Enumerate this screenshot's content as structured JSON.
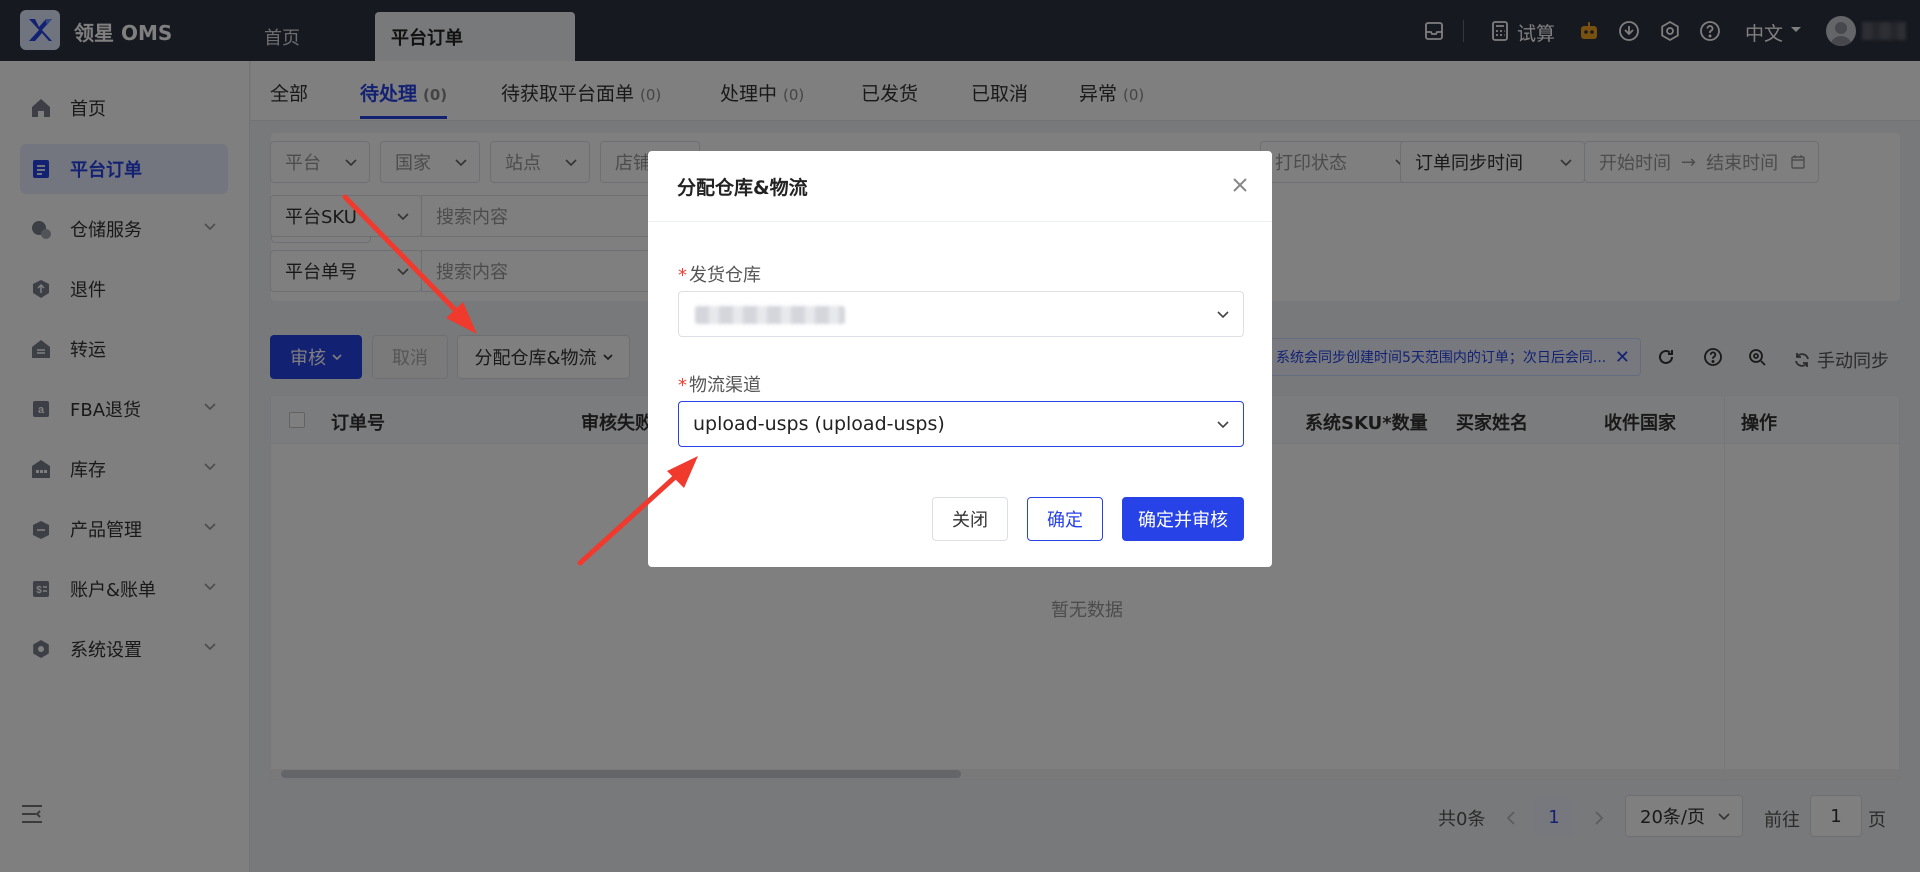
{
  "app": {
    "name": "领星 OMS"
  },
  "top_tabs": [
    {
      "label": "首页",
      "active": false
    },
    {
      "label": "平台订单",
      "active": true
    }
  ],
  "top_right": {
    "trial_label": "试算",
    "language": "中文",
    "icons": [
      "inbox-icon",
      "calculator-icon",
      "robot-icon",
      "download-icon",
      "settings-icon",
      "help-icon",
      "avatar"
    ]
  },
  "sidebar": {
    "items": [
      {
        "label": "首页",
        "icon": "home-icon",
        "active": false,
        "expandable": false
      },
      {
        "label": "平台订单",
        "icon": "order-icon",
        "active": true,
        "expandable": false
      },
      {
        "label": "仓储服务",
        "icon": "warehouse-service-icon",
        "active": false,
        "expandable": true
      },
      {
        "label": "退件",
        "icon": "return-icon",
        "active": false,
        "expandable": false
      },
      {
        "label": "转运",
        "icon": "transfer-icon",
        "active": false,
        "expandable": false
      },
      {
        "label": "FBA退货",
        "icon": "amazon-icon",
        "active": false,
        "expandable": true
      },
      {
        "label": "库存",
        "icon": "inventory-icon",
        "active": false,
        "expandable": true
      },
      {
        "label": "产品管理",
        "icon": "product-icon",
        "active": false,
        "expandable": true
      },
      {
        "label": "账户&账单",
        "icon": "billing-icon",
        "active": false,
        "expandable": true
      },
      {
        "label": "系统设置",
        "icon": "system-settings-icon",
        "active": false,
        "expandable": true
      }
    ]
  },
  "sub_tabs": [
    {
      "label": "全部",
      "count": ""
    },
    {
      "label": "待处理",
      "count": "(0)"
    },
    {
      "label": "待获取平台面单",
      "count": "(0)"
    },
    {
      "label": "处理中",
      "count": "(0)"
    },
    {
      "label": "已发货",
      "count": ""
    },
    {
      "label": "已取消",
      "count": ""
    },
    {
      "label": "异常",
      "count": "(0)"
    }
  ],
  "filters": {
    "platform": "平台",
    "country": "国家",
    "site": "站点",
    "store": "店铺",
    "print_status": "打印状态",
    "sync_time": "订单同步时间",
    "start_time": "开始时间",
    "end_time": "结束时间",
    "sku_type": "平台SKU",
    "sku_placeholder": "搜索内容",
    "order_type": "平台单号",
    "order_placeholder": "搜索内容"
  },
  "actions": {
    "review": "审核",
    "cancel": "取消",
    "assign": "分配仓库&物流",
    "notice": "系统会同步创建时间5天范围内的订单；次日后会同...",
    "manual_sync": "手动同步"
  },
  "table": {
    "columns": [
      "订单号",
      "审核失败",
      "系统SKU*数量",
      "买家姓名",
      "收件国家",
      "操作"
    ],
    "empty_text": "暂无数据"
  },
  "pagination": {
    "total": "共0条",
    "current_page": "1",
    "page_size": "20条/页",
    "goto_label": "前往",
    "goto_value": "1",
    "page_unit": "页"
  },
  "modal": {
    "title": "分配仓库&物流",
    "warehouse_label": "发货仓库",
    "logistics_label": "物流渠道",
    "logistics_value": "upload-usps (upload-usps)",
    "close_button": "关闭",
    "confirm_button": "确定",
    "confirm_review_button": "确定并审核"
  },
  "colors": {
    "primary": "#2742e6",
    "topbar": "#2e3240",
    "arrow": "#f03a2e",
    "required": "#f04134"
  }
}
